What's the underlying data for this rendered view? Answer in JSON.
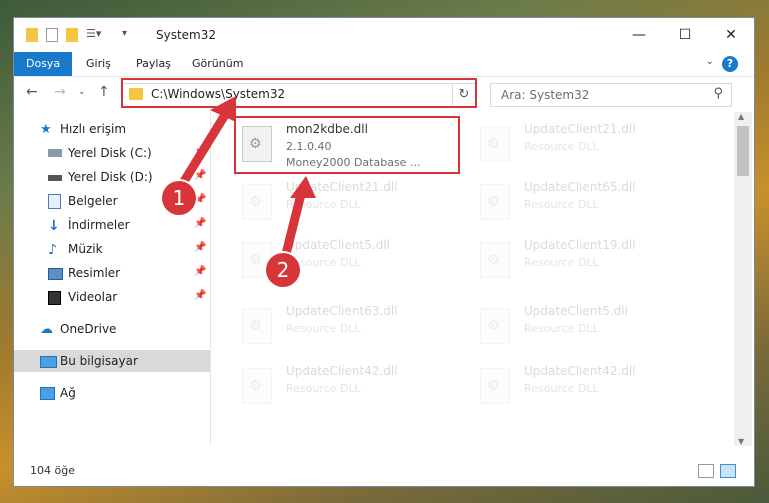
{
  "window": {
    "title": "System32",
    "controls": {
      "minimize": "—",
      "maximize": "☐",
      "close": "✕"
    }
  },
  "ribbon": {
    "tabs": [
      {
        "label": "Dosya",
        "active": true
      },
      {
        "label": "Giriş"
      },
      {
        "label": "Paylaş"
      },
      {
        "label": "Görünüm"
      }
    ],
    "help": "?"
  },
  "address": {
    "path": "C:\\Windows\\System32",
    "search_placeholder": "Ara: System32"
  },
  "sidebar": {
    "items": [
      {
        "label": "Hızlı erişim",
        "icon": "star-icon"
      },
      {
        "label": "Yerel Disk (C:)",
        "icon": "drive-icon",
        "pinned": true
      },
      {
        "label": "Yerel Disk (D:)",
        "icon": "drive-icon",
        "pinned": true
      },
      {
        "label": "Belgeler",
        "icon": "documents-icon",
        "pinned": true
      },
      {
        "label": "İndirmeler",
        "icon": "download-icon",
        "pinned": true
      },
      {
        "label": "Müzik",
        "icon": "music-icon",
        "pinned": true
      },
      {
        "label": "Resimler",
        "icon": "pictures-icon",
        "pinned": true
      },
      {
        "label": "Videolar",
        "icon": "video-icon",
        "pinned": true
      },
      {
        "label": "OneDrive",
        "icon": "cloud-icon"
      },
      {
        "label": "Bu bilgisayar",
        "icon": "computer-icon",
        "selected": true
      },
      {
        "label": "Ağ",
        "icon": "network-icon"
      }
    ]
  },
  "files": {
    "highlighted": {
      "name": "mon2kdbe.dll",
      "version": "2.1.0.40",
      "description": "Money2000 Database ..."
    },
    "left_column": [
      {
        "name": "UpdateClient21.dll",
        "description": "Resource DLL"
      },
      {
        "name": "UpdateClient5.dll",
        "description": "Resource DLL"
      },
      {
        "name": "UpdateClient63.dll",
        "description": "Resource DLL"
      },
      {
        "name": "UpdateClient42.dll",
        "description": "Resource DLL"
      }
    ],
    "right_column": [
      {
        "name": "UpdateClient21.dll",
        "description": "Resource DLL"
      },
      {
        "name": "UpdateClient65.dll",
        "description": "Resource DLL"
      },
      {
        "name": "UpdateClient19.dll",
        "description": "Resource DLL"
      },
      {
        "name": "UpdateClient5.dll",
        "description": "Resource DLL"
      },
      {
        "name": "UpdateClient42.dll",
        "description": "Resource DLL"
      }
    ]
  },
  "status": {
    "item_count": "104 öğe"
  },
  "annotations": {
    "step1": "1",
    "step2": "2",
    "color": "#d8353a"
  }
}
